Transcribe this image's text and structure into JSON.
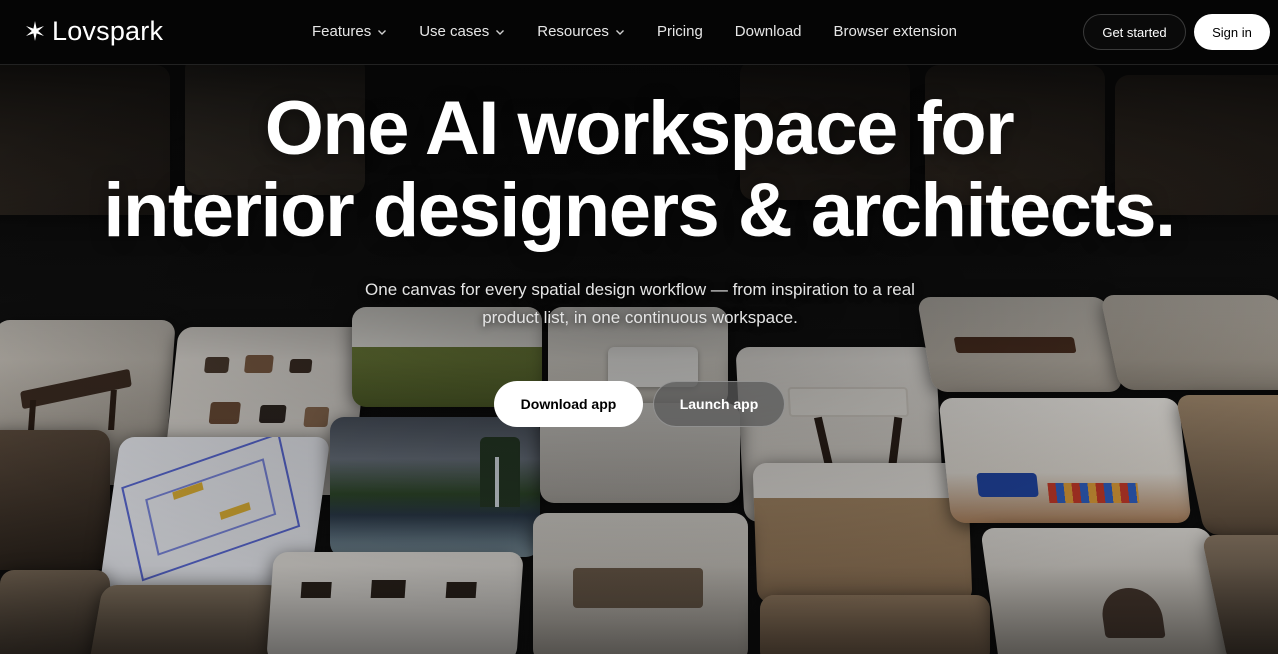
{
  "nav": {
    "brand": "Lovspark",
    "items": [
      {
        "label": "Features",
        "has_dropdown": true
      },
      {
        "label": "Use cases",
        "has_dropdown": true
      },
      {
        "label": "Resources",
        "has_dropdown": true
      },
      {
        "label": "Pricing",
        "has_dropdown": false
      },
      {
        "label": "Download",
        "has_dropdown": false
      },
      {
        "label": "Browser extension",
        "has_dropdown": false
      }
    ],
    "get_started": "Get started",
    "sign_in": "Sign in"
  },
  "hero": {
    "title_line1": "One AI workspace for",
    "title_line2": "interior designers & architects.",
    "subtitle_line1": "One canvas for every spatial design workflow — from inspiration to a real",
    "subtitle_line2": "product list, in one continuous workspace.",
    "download_app": "Download app",
    "launch_app": "Launch app"
  },
  "icons": {
    "logo": "sparkle-icon",
    "dropdown": "chevron-down-icon"
  },
  "colors": {
    "background": "#0a0a0a",
    "primary_button": "#ffffff",
    "text": "#ffffff"
  }
}
